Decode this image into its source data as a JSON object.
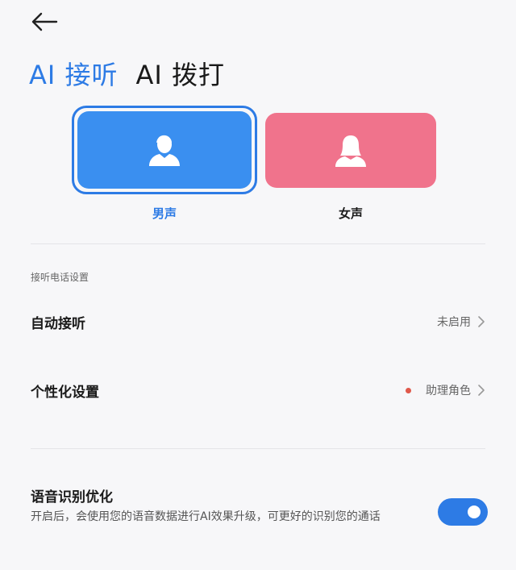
{
  "header": {
    "back_icon": "arrow-left-icon"
  },
  "tabs": [
    {
      "label": "AI 接听",
      "active": true
    },
    {
      "label": "AI 拨打",
      "active": false
    }
  ],
  "voices": {
    "male": {
      "label": "男声",
      "icon": "male-avatar-icon",
      "color": "#3a8ff0",
      "selected": true
    },
    "female": {
      "label": "女声",
      "icon": "female-avatar-icon",
      "color": "#f0738c",
      "selected": false
    }
  },
  "call_settings": {
    "section_title": "接听电话设置",
    "auto_answer": {
      "title": "自动接听",
      "value": "未启用"
    },
    "personalization": {
      "title": "个性化设置",
      "value": "助理角色",
      "status_dot_color": "#e0584a"
    }
  },
  "speech_optimization": {
    "title": "语音识别优化",
    "description": "开启后，会使用您的语音数据进行AI效果升级，可更好的识别您的通话",
    "enabled": true
  },
  "colors": {
    "accent": "#2d7be5",
    "background": "#f7f7f9"
  }
}
